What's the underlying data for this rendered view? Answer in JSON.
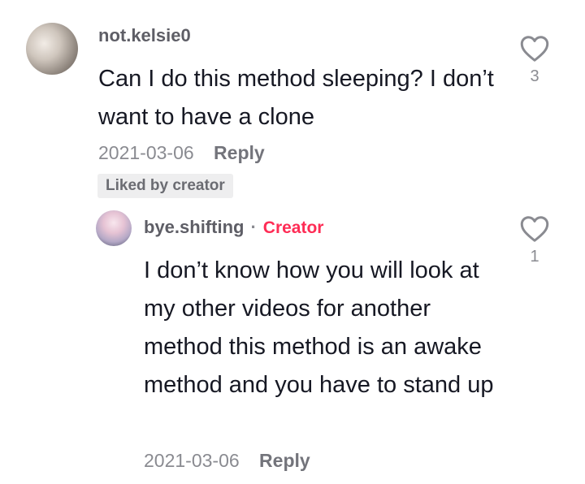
{
  "comment": {
    "username": "not.kelsie0",
    "text": "Can I do this method sleeping? I don’t want to have a clone",
    "date": "2021-03-06",
    "reply_label": "Reply",
    "liked_badge": "Liked by creator",
    "like_count": "3",
    "like_icon": "heart-outline-icon"
  },
  "reply": {
    "username": "bye.shifting",
    "separator": "·",
    "creator_label": "Creator",
    "creator_color": "#fe2c55",
    "text": "I don’t know how you will look at my other videos for another method this method is an awake method and you have to stand up",
    "date": "2021-03-06",
    "reply_label": "Reply",
    "like_count": "1",
    "like_icon": "heart-outline-icon"
  }
}
